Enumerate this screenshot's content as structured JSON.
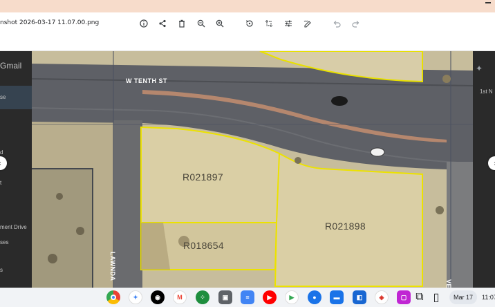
{
  "window": {
    "title": "nshot 2026-03-17 11.07.00.png",
    "minimize_icon": "minimize-icon"
  },
  "toolbar": {
    "buttons": [
      {
        "name": "info",
        "icon": "info-icon"
      },
      {
        "name": "share",
        "icon": "share-icon"
      },
      {
        "name": "delete",
        "icon": "trash-icon"
      },
      {
        "name": "zoom-out",
        "icon": "zoom-out-icon"
      },
      {
        "name": "zoom-in",
        "icon": "zoom-in-icon"
      },
      {
        "name": "rotate",
        "icon": "rotate-icon"
      },
      {
        "name": "crop",
        "icon": "crop-icon"
      },
      {
        "name": "adjust",
        "icon": "sliders-icon"
      },
      {
        "name": "annotate",
        "icon": "pen-icon"
      },
      {
        "name": "undo",
        "icon": "undo-icon"
      },
      {
        "name": "redo",
        "icon": "redo-icon"
      }
    ]
  },
  "background": {
    "left_texts": [
      "Gmail",
      "se",
      "d",
      "t",
      "ment Drive",
      "ses",
      "s"
    ],
    "right_texts": [
      "1st N"
    ]
  },
  "image": {
    "street": "W TENTH ST",
    "cross_street": "LAWNDA",
    "right_street": "VE",
    "parcels": [
      "R021897",
      "R021898",
      "R018654"
    ]
  },
  "shelf": {
    "apps": [
      {
        "name": "chrome",
        "icon": "chrome-icon",
        "color": "#ffffff"
      },
      {
        "name": "gemini",
        "icon": "gemini-icon",
        "color": "#ffffff"
      },
      {
        "name": "podcast",
        "icon": "podcast-icon",
        "color": "#000000"
      },
      {
        "name": "gmail",
        "icon": "gmail-icon",
        "color": "#ffffff"
      },
      {
        "name": "sheets-app",
        "icon": "apps-grid-icon",
        "color": "#1e8e3e"
      },
      {
        "name": "media",
        "icon": "media-icon",
        "color": "#5f6368"
      },
      {
        "name": "docs",
        "icon": "docs-icon",
        "color": "#4285f4"
      },
      {
        "name": "youtube",
        "icon": "youtube-icon",
        "color": "#ff0000"
      },
      {
        "name": "play-store",
        "icon": "play-icon",
        "color": "#ffffff"
      },
      {
        "name": "messages",
        "icon": "messages-icon",
        "color": "#1a73e8"
      },
      {
        "name": "files",
        "icon": "folder-icon",
        "color": "#1a73e8"
      },
      {
        "name": "camera",
        "icon": "camera-icon",
        "color": "#1967d2"
      },
      {
        "name": "photos-web",
        "icon": "web-icon",
        "color": "#ffffff"
      },
      {
        "name": "screenshot-app",
        "icon": "screenshot-icon",
        "color": "#c026d3"
      }
    ],
    "date": "Mar 17",
    "time": "11:07"
  }
}
